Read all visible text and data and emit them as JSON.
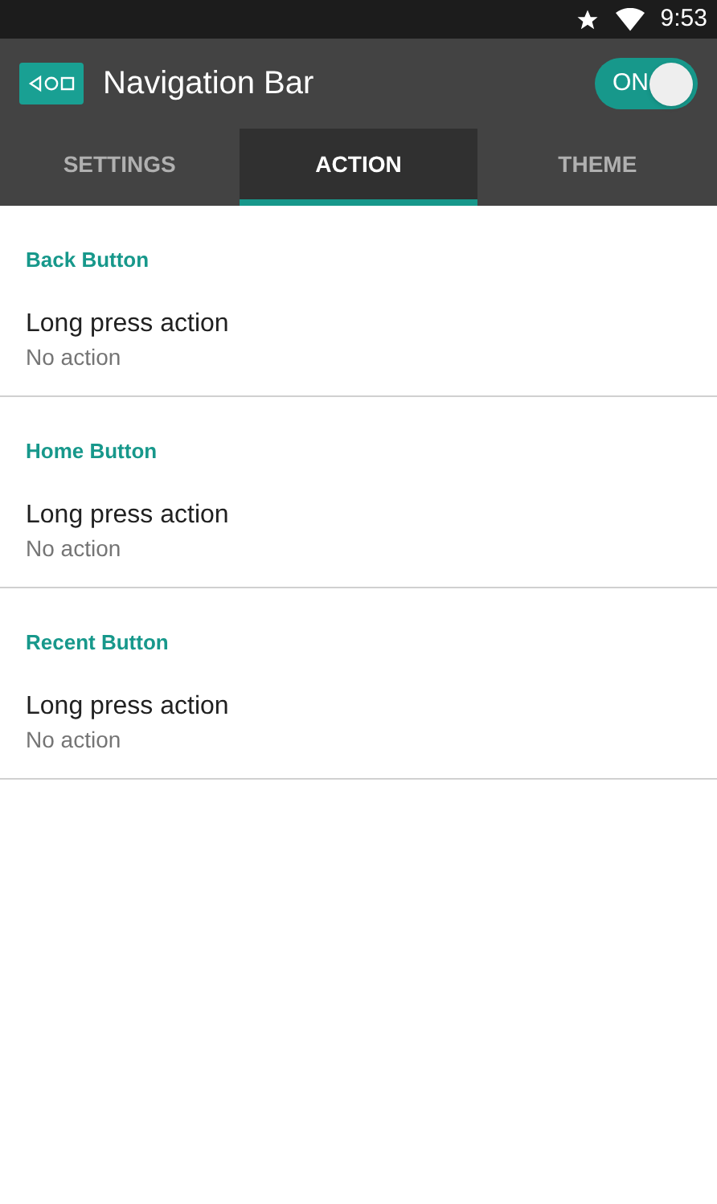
{
  "status_bar": {
    "time": "9:53"
  },
  "app_bar": {
    "title": "Navigation Bar",
    "switch": {
      "label": "ON",
      "on": true
    }
  },
  "tabs": [
    {
      "label": "SETTINGS",
      "selected": false
    },
    {
      "label": "ACTION",
      "selected": true
    },
    {
      "label": "THEME",
      "selected": false
    }
  ],
  "sections": [
    {
      "header": "Back Button",
      "items": [
        {
          "title": "Long press action",
          "summary": "No action"
        }
      ]
    },
    {
      "header": "Home Button",
      "items": [
        {
          "title": "Long press action",
          "summary": "No action"
        }
      ]
    },
    {
      "header": "Recent Button",
      "items": [
        {
          "title": "Long press action",
          "summary": "No action"
        }
      ]
    }
  ]
}
